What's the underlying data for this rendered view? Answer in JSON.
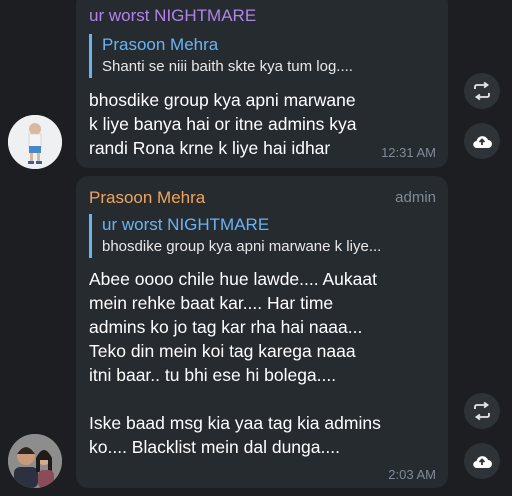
{
  "messages": [
    {
      "sender": "ur worst NIGHTMARE",
      "sender_color": "#b084ec",
      "reply": {
        "name": "Prasoon Mehra",
        "text": "Shanti se niii baith skte kya tum log...."
      },
      "text": "bhosdike group kya apni marwane\nk liye banya hai or itne admins kya\nrandi Rona krne k liye hai idhar",
      "time": "12:31 AM"
    },
    {
      "sender": "Prasoon Mehra",
      "sender_color": "#f0a45d",
      "badge": "admin",
      "reply": {
        "name": "ur worst NIGHTMARE",
        "text": "bhosdike group kya apni marwane k liye..."
      },
      "text": "Abee oooo chile hue lawde.... Aukaat\nmein rehke baat kar.... Har time\nadmins ko jo tag kar rha hai naaa...\nTeko din mein koi tag karega naaa\nitni baar.. tu bhi ese hi bolega....\n\nIske baad msg kia yaa tag kia admins\nko.... Blacklist mein dal dunga....",
      "time": "2:03 AM"
    }
  ],
  "icons": {
    "forward": "repeat-arrows-icon",
    "upload": "cloud-upload-icon"
  }
}
